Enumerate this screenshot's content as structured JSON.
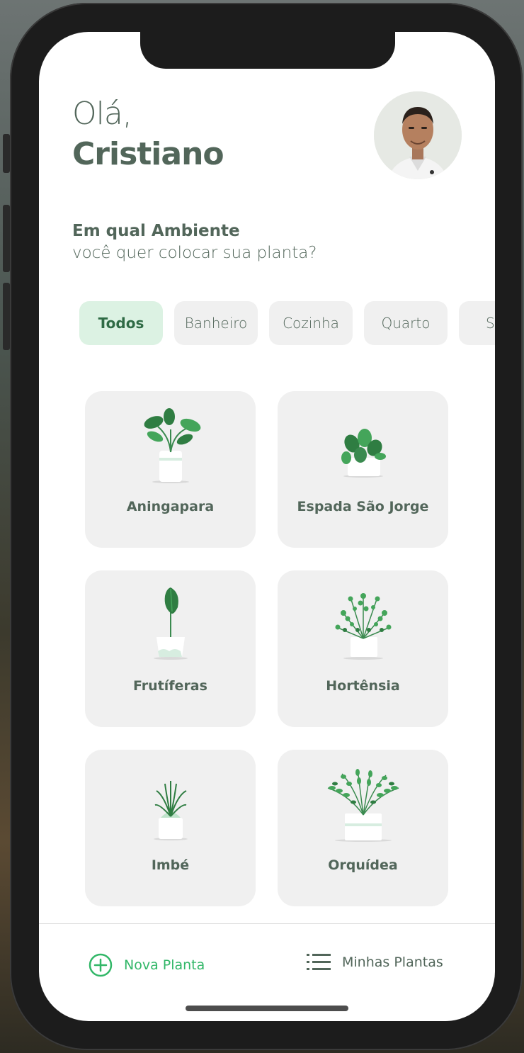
{
  "greeting": {
    "hello": "Olá,",
    "name": "Cristiano"
  },
  "avatar": {
    "alt": "user-avatar"
  },
  "question": {
    "line1": "Em qual Ambiente",
    "line2": "você quer colocar sua planta?"
  },
  "environments": [
    {
      "label": "Todos",
      "active": true
    },
    {
      "label": "Banheiro",
      "active": false
    },
    {
      "label": "Cozinha",
      "active": false
    },
    {
      "label": "Quarto",
      "active": false
    },
    {
      "label": "S",
      "active": false
    }
  ],
  "plants": [
    {
      "name": "Aningapara",
      "icon": "potted-plant-icon"
    },
    {
      "name": "Espada São Jorge",
      "icon": "potted-plant-icon"
    },
    {
      "name": "Frutíferas",
      "icon": "potted-plant-icon"
    },
    {
      "name": "Hortênsia",
      "icon": "potted-plant-icon"
    },
    {
      "name": "Imbé",
      "icon": "potted-plant-icon"
    },
    {
      "name": "Orquídea",
      "icon": "potted-plant-icon"
    }
  ],
  "tabbar": {
    "new_plant": "Nova Planta",
    "my_plants": "Minhas Plantas"
  },
  "colors": {
    "accent": "#32b768",
    "heading": "#52665a",
    "chip_active_bg": "#dcf2e3",
    "card_bg": "#f0f0f0"
  }
}
